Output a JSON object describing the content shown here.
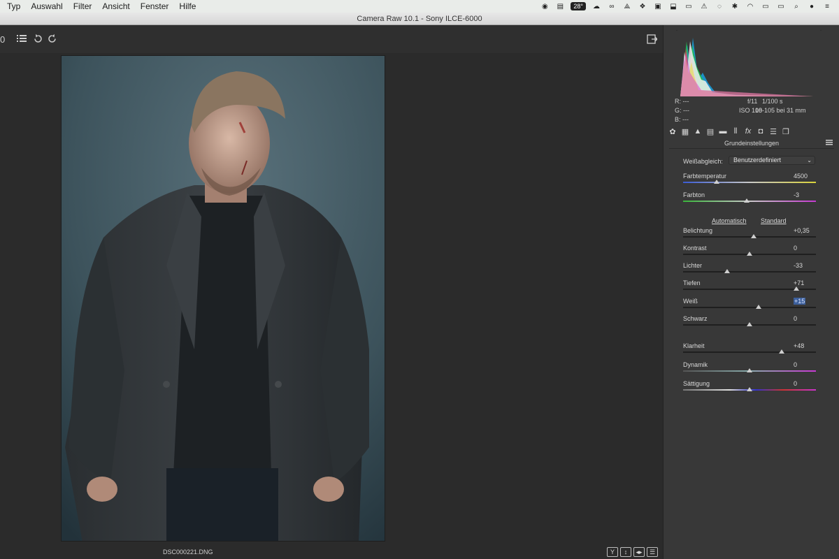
{
  "menubar": {
    "items": [
      "Typ",
      "Auswahl",
      "Filter",
      "Ansicht",
      "Fenster",
      "Hilfe"
    ],
    "temperature_badge": "28°"
  },
  "window": {
    "title": "Camera Raw 10.1 - Sony ILCE-6000"
  },
  "toolbar": {
    "zoom_partial": "0"
  },
  "image": {
    "filename": "DSC000221.DNG"
  },
  "histogram": {
    "rgb": {
      "r_label": "R:",
      "g_label": "G:",
      "b_label": "B:",
      "r": "---",
      "g": "---",
      "b": "---"
    },
    "aperture": "f/11",
    "shutter": "1/100 s",
    "iso": "ISO 100",
    "lens": "18-105 bei 31 mm"
  },
  "panel": {
    "section_title": "Grundeinstellungen",
    "white_balance_label": "Weißabgleich:",
    "white_balance_value": "Benutzerdefiniert",
    "auto_label": "Automatisch",
    "standard_label": "Standard",
    "sliders": [
      {
        "label": "Farbtemperatur",
        "value": "4500",
        "pos": 0.25,
        "track": "temp"
      },
      {
        "label": "Farbton",
        "value": "-3",
        "pos": 0.48,
        "track": "tint"
      },
      {
        "label": "Belichtung",
        "value": "+0,35",
        "pos": 0.53,
        "track": "plain"
      },
      {
        "label": "Kontrast",
        "value": "0",
        "pos": 0.5,
        "track": "plain"
      },
      {
        "label": "Lichter",
        "value": "-33",
        "pos": 0.33,
        "track": "plain"
      },
      {
        "label": "Tiefen",
        "value": "+71",
        "pos": 0.85,
        "track": "plain"
      },
      {
        "label": "Weiß",
        "value": "+15",
        "pos": 0.57,
        "track": "plain",
        "highlight": true
      },
      {
        "label": "Schwarz",
        "value": "0",
        "pos": 0.5,
        "track": "plain"
      },
      {
        "label": "Klarheit",
        "value": "+48",
        "pos": 0.74,
        "track": "plain"
      },
      {
        "label": "Dynamik",
        "value": "0",
        "pos": 0.5,
        "track": "vib"
      },
      {
        "label": "Sättigung",
        "value": "0",
        "pos": 0.5,
        "track": "sat"
      }
    ]
  },
  "view_buttons": [
    "Y",
    "↕",
    "◂▸",
    "☰"
  ],
  "colors": {
    "panel_bg": "#383838",
    "canvas_bg": "#2b2b2b",
    "highlight": "#3c5f9c"
  }
}
